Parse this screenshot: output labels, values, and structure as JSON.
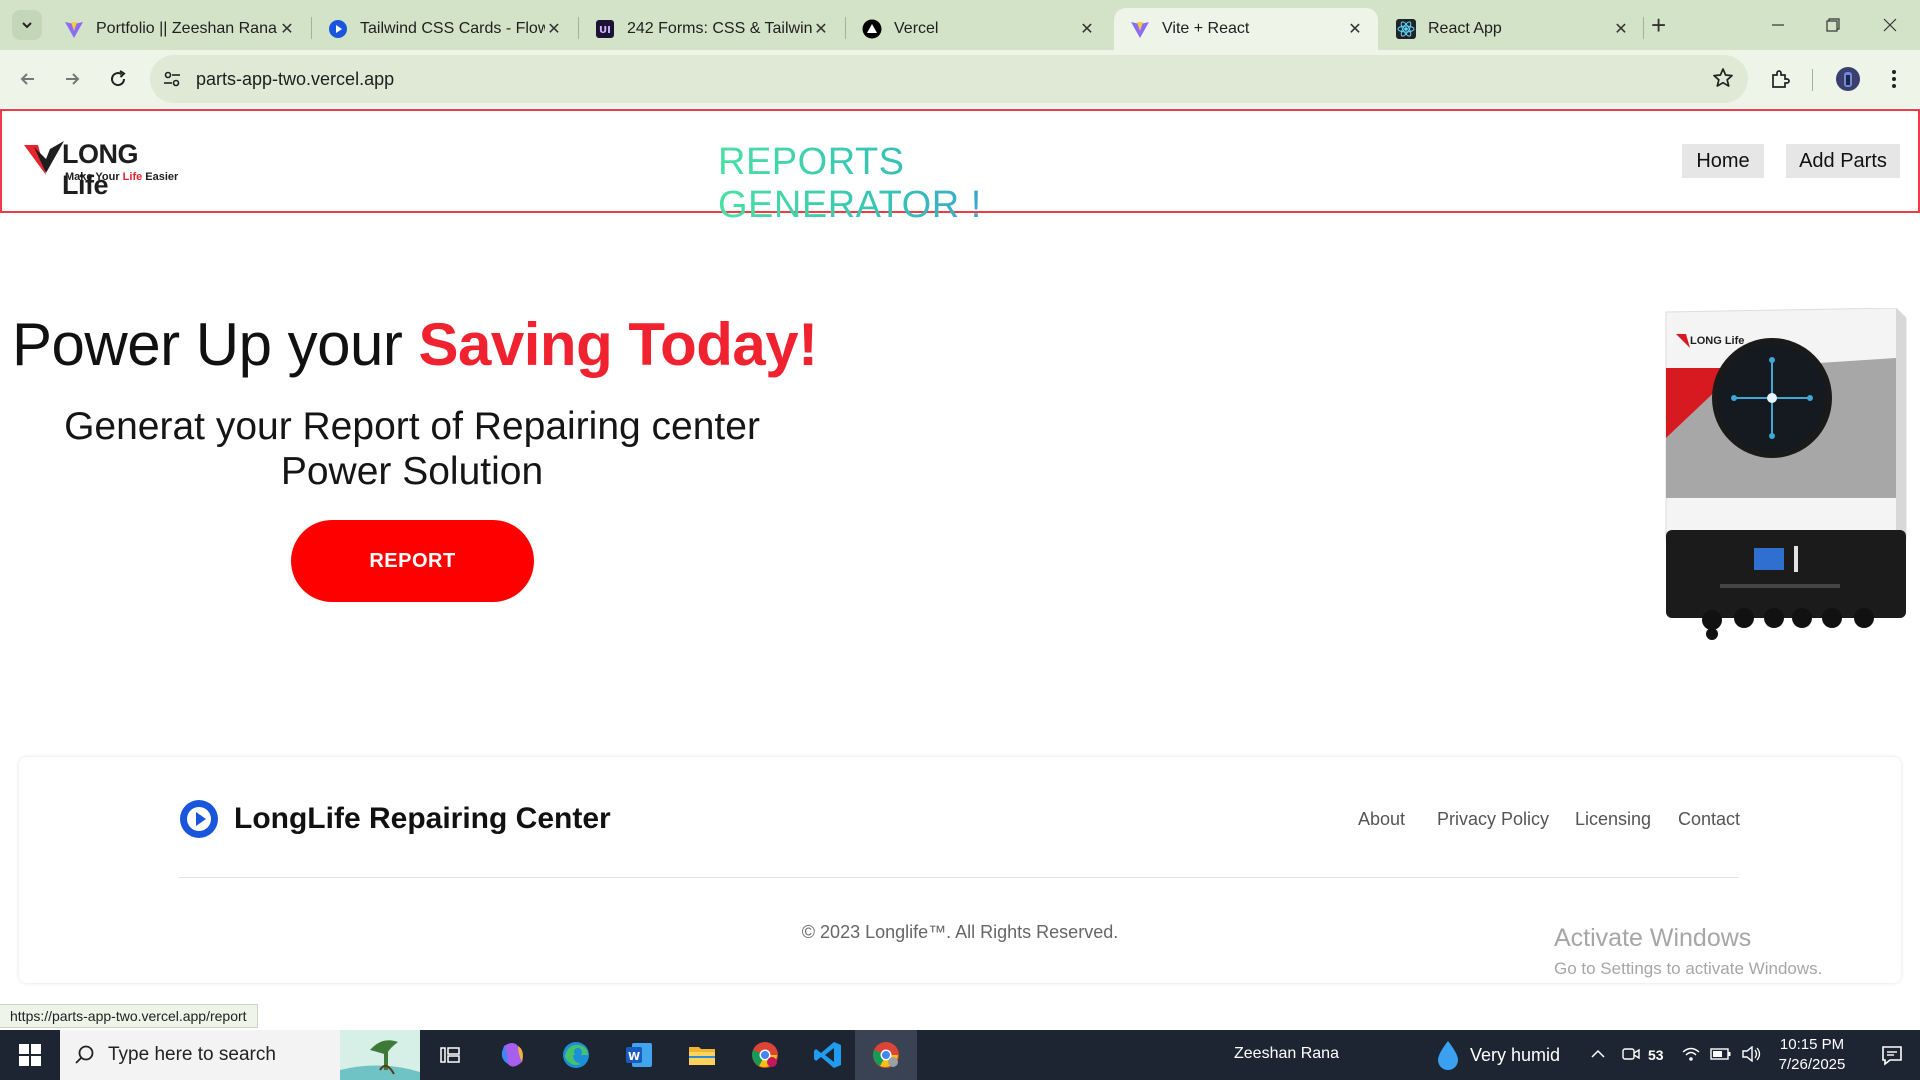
{
  "browser": {
    "tabs": [
      {
        "title": "Portfolio || Zeeshan Rana",
        "icon": "vite-icon",
        "active": false
      },
      {
        "title": "Tailwind CSS Cards - Flowbite",
        "icon": "flowbite-icon",
        "active": false
      },
      {
        "title": "242 Forms: CSS & Tailwind",
        "icon": "uiverse-icon",
        "active": false
      },
      {
        "title": "Vercel",
        "icon": "vercel-icon",
        "active": false
      },
      {
        "title": "Vite + React",
        "icon": "vite-icon",
        "active": true
      },
      {
        "title": "React App",
        "icon": "react-icon",
        "active": false
      }
    ],
    "url": "parts-app-two.vercel.app",
    "status_url": "https://parts-app-two.vercel.app/report"
  },
  "header": {
    "logo_text_long": "LONG",
    "logo_text_life": "Life",
    "logo_tagline_1": "Make Your ",
    "logo_tagline_2": "Life",
    "logo_tagline_3": " Easier",
    "title": "REPORTS GENERATOR !",
    "nav": [
      {
        "label": "Home"
      },
      {
        "label": "Add Parts"
      }
    ]
  },
  "hero": {
    "headline_plain": "Power Up your ",
    "headline_accent": "Saving Today!",
    "subtitle": "Generat your Report of Repairing center Power Solution",
    "cta_label": "REPORT",
    "product_logo_text": "LONG Life"
  },
  "footer": {
    "brand": "LongLife Repairing Center",
    "links": [
      "About",
      "Privacy Policy",
      "Licensing",
      "Contact"
    ],
    "copyright": "© 2023 Longlife™. All Rights Reserved."
  },
  "windows_watermark": {
    "line1": "Activate Windows",
    "line2": "Go to Settings to activate Windows."
  },
  "taskbar": {
    "search_placeholder": "Type here to search",
    "user": "Zeeshan Rana",
    "weather": "Very humid",
    "tray_count": "53",
    "time": "10:15 PM",
    "date": "7/26/2025"
  },
  "colors": {
    "accent_red": "#f0222f",
    "cta_red": "#ff0000",
    "header_border": "#ef3b45",
    "title_gradient_start": "#49e0a4",
    "title_gradient_end": "#3b7ae8"
  }
}
